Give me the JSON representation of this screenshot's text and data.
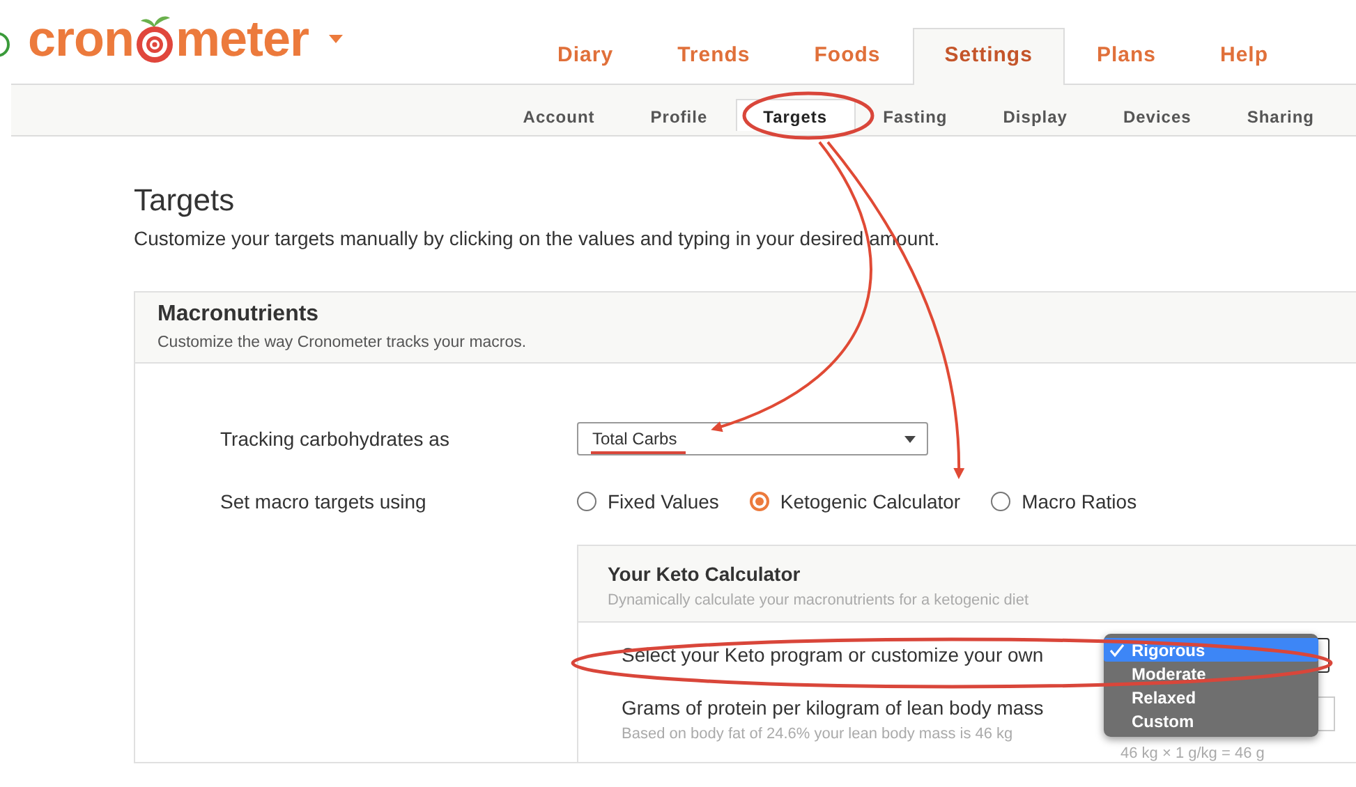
{
  "header": {
    "logo_start": "cron",
    "logo_end": "meter"
  },
  "nav_tabs": [
    {
      "label": "Diary",
      "selected": false
    },
    {
      "label": "Trends",
      "selected": false
    },
    {
      "label": "Foods",
      "selected": false
    },
    {
      "label": "Settings",
      "selected": true
    },
    {
      "label": "Plans",
      "selected": false
    },
    {
      "label": "Help",
      "selected": false
    }
  ],
  "sub_tabs": [
    {
      "label": "Account",
      "selected": false
    },
    {
      "label": "Profile",
      "selected": false
    },
    {
      "label": "Targets",
      "selected": true
    },
    {
      "label": "Fasting",
      "selected": false
    },
    {
      "label": "Display",
      "selected": false
    },
    {
      "label": "Devices",
      "selected": false
    },
    {
      "label": "Sharing",
      "selected": false
    }
  ],
  "page": {
    "title": "Targets",
    "subtitle": "Customize your targets manually by clicking on the values and typing in your desired amount."
  },
  "macronutrients": {
    "title": "Macronutrients",
    "subtitle": "Customize the way Cronometer tracks your macros.",
    "carbs_label": "Tracking carbohydrates as",
    "carbs_value": "Total Carbs",
    "method_label": "Set macro targets using",
    "methods": [
      {
        "label": "Fixed Values",
        "selected": false
      },
      {
        "label": "Ketogenic Calculator",
        "selected": true
      },
      {
        "label": "Macro Ratios",
        "selected": false
      }
    ]
  },
  "keto_calculator": {
    "title": "Your Keto Calculator",
    "subtitle": "Dynamically calculate your macronutrients for a ketogenic diet",
    "program_label": "Select your Keto program or customize your own",
    "program_options": [
      {
        "label": "Rigorous",
        "selected": true
      },
      {
        "label": "Moderate",
        "selected": false
      },
      {
        "label": "Relaxed",
        "selected": false
      },
      {
        "label": "Custom",
        "selected": false
      }
    ],
    "protein_label": "Grams of protein per kilogram of lean body mass",
    "protein_note": "Based on body fat of 24.6% your lean body mass is 46 kg",
    "protein_formula": "46 kg × 1 g/kg = 46 g"
  }
}
